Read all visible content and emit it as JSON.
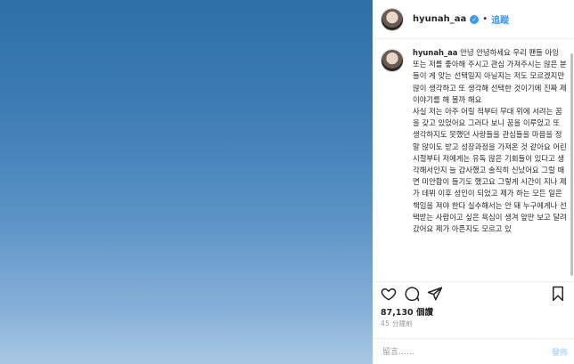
{
  "post": {
    "username": "hyunah_aa",
    "follow_label": "追蹤",
    "separator": "•",
    "verified_mark": "✓",
    "caption_username": "hyunah_aa",
    "caption_text": "안녕 안녕하세요 우리 팬들 아잉 또는 저를 좋아해 주시고 관심 가져주시는 많은 분들이 게 맞는 선택일지 아닐지는 저도 모르겠지만 많이 생각하고 또 생각해 선택한 것이기에 진짜 제 이야기를 해 볼까 해요\n사실 저는 아주 어릴 적부터 무대 위에 서려는 꿈을 갖고 있었어요 그러다 보니 꿈을 이루었고 또 생각하지도 못했던 사랑들을 관심들을 마음을 정말 많이도 받고 성장과정을 가져온 것 같아요 어린 시절부터 저에게는 유독 많은 기회들이 있다고 생각해서인지 늘 감사했고 솔직히 신났어요 그럴 때면 미안함이 들기도 했고요 그렇게 시간이 지나 제가 데뷔 이후 성인이 되었고 제가 하는 모든 일은 책임을 져야 한다 실수해서는 안 돼 누구에게나 선택받는 사람이고 싶은 욕심이 생겨 앞만 보고 달려갔어요 제가 아픈지도 모르고 있",
    "likes": "87,130 個讚",
    "time_ago": "45 分鐘前",
    "comment_placeholder": "留言……",
    "post_label": "發佈"
  },
  "colors": {
    "accent": "#3897f0",
    "text": "#262626",
    "muted": "#999999",
    "sky_top": "#2f6fa8",
    "sky_bottom": "#a8c7e4"
  },
  "icons": [
    "heart-icon",
    "comment-icon",
    "share-icon",
    "bookmark-icon",
    "verified-badge-icon"
  ]
}
